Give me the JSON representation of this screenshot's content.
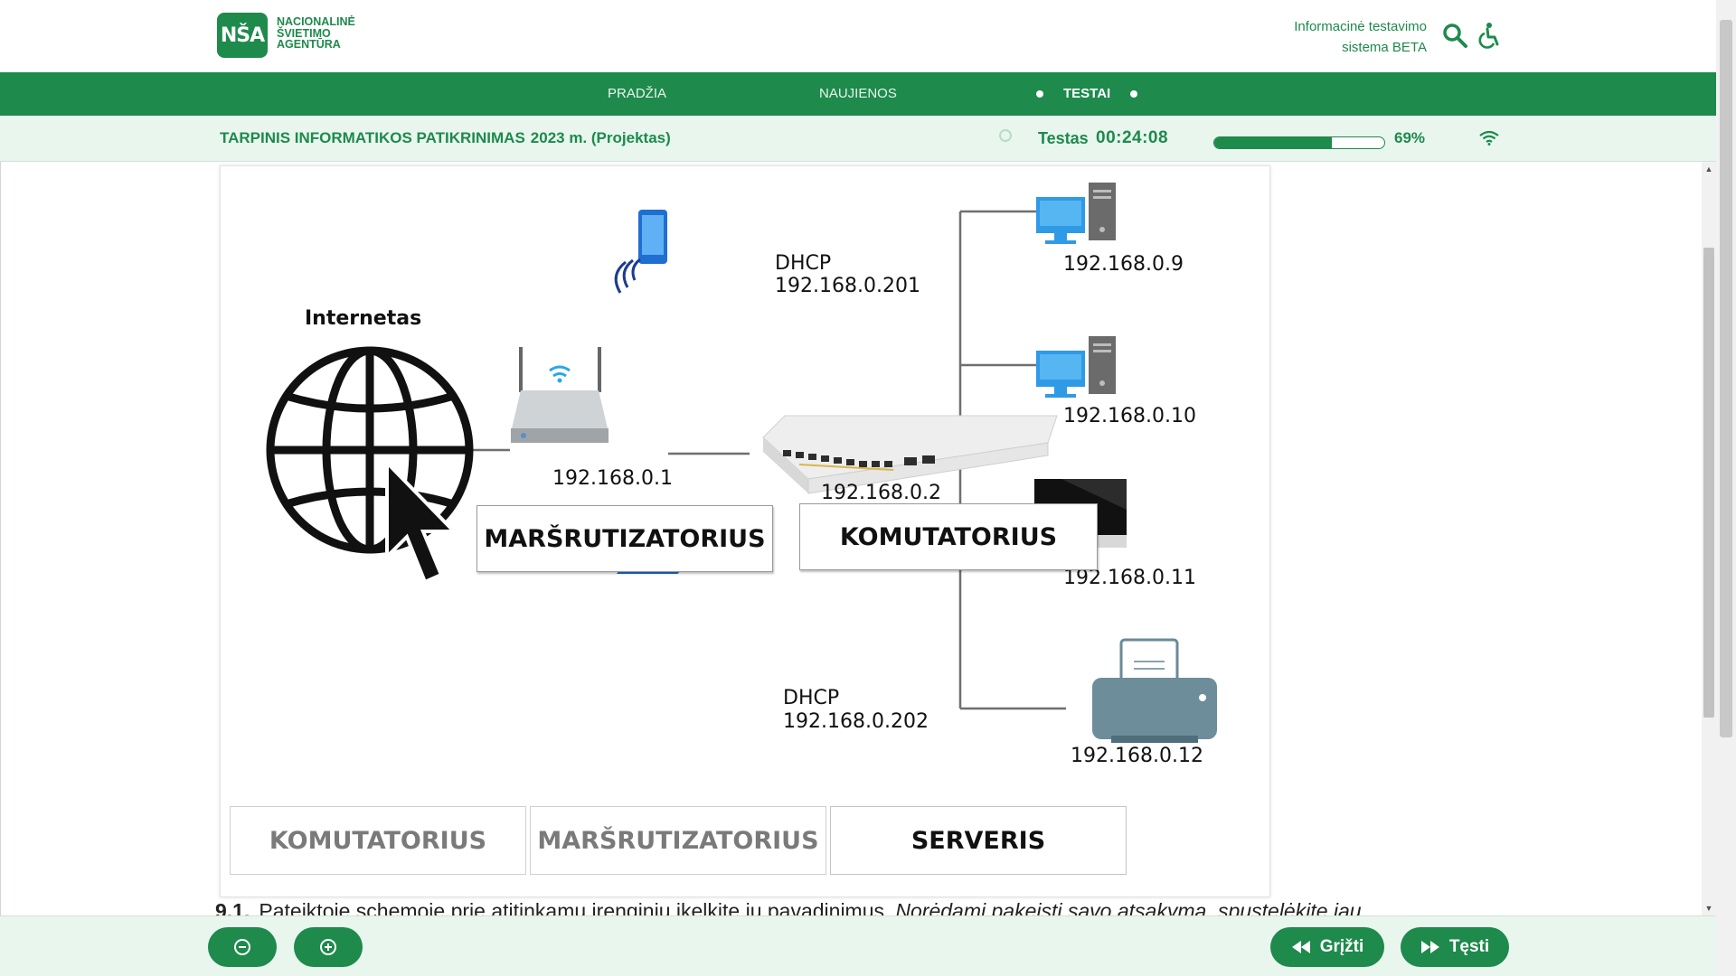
{
  "header": {
    "logo_mark": "NŠA",
    "logo_lines": [
      "Nacionalinė",
      "Švietimo",
      "Agentūra"
    ],
    "system_name_line1": "Informacinė testavimo",
    "system_name_line2": "sistema BETA"
  },
  "nav": {
    "items": [
      {
        "label": "PRADŽIA",
        "active": false
      },
      {
        "label": "NAUJIENOS",
        "active": false
      },
      {
        "label": "TESTAI",
        "active": true
      }
    ]
  },
  "testbar": {
    "title": "TARPINIS INFORMATIKOS PATIKRINIMAS",
    "subtitle": "2023 m. (Projektas)",
    "timer_label": "Testas",
    "timer": "00:24:08",
    "progress_fraction": 0.69,
    "progress_text": "69%"
  },
  "diagram": {
    "internet_label": "Internetas",
    "phone_dhcp": "DHCP",
    "phone_ip": "192.168.0.201",
    "laptop_dhcp": "DHCP",
    "laptop_ip": "192.168.0.202",
    "router_ip": "192.168.0.1",
    "switch_ip": "192.168.0.2",
    "pc1_ip": "192.168.0.9",
    "pc2_ip": "192.168.0.10",
    "monitor_ip": "192.168.0.11",
    "printer_ip": "192.168.0.12",
    "placed_router_label": "MARŠRUTIZATORIUS",
    "placed_switch_label": "KOMUTATORIUS",
    "choices": [
      {
        "label": "KOMUTATORIUS",
        "used": true
      },
      {
        "label": "MARŠRUTIZATORIUS",
        "used": true
      },
      {
        "label": "SERVERIS",
        "used": false
      }
    ]
  },
  "question": {
    "number": "9.1.",
    "text": "Pateiktoje schemoje prie atitinkamų įrenginių įkelkite jų pavadinimus.",
    "hint": "Norėdami pakeisti savo atsakymą, spustelėkite jau"
  },
  "footer": {
    "back_label": "Grįžti",
    "next_label": "Tęsti"
  },
  "colors": {
    "brand_green": "#1e8a4c",
    "light_green_bg": "#e8f6ee"
  }
}
